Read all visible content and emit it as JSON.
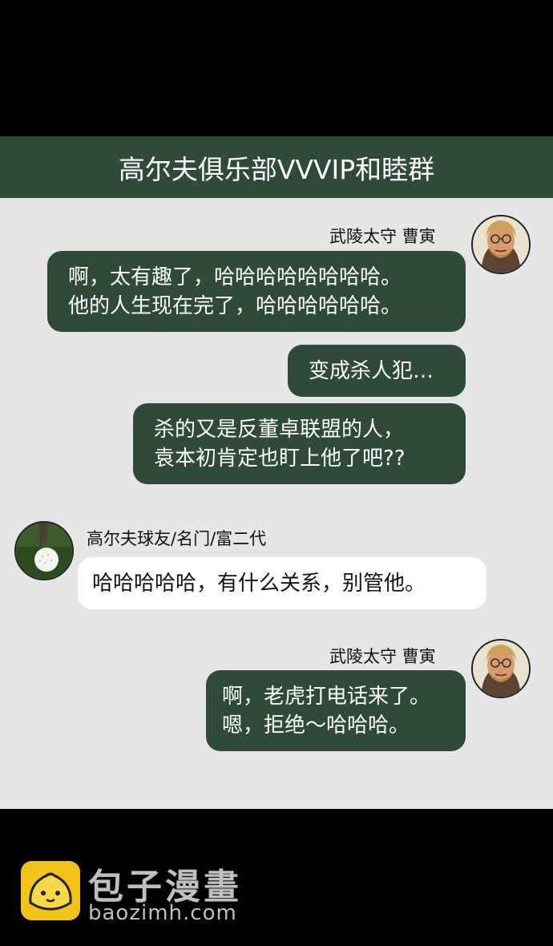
{
  "header": {
    "title": "高尔夫俱乐部VVVIP和睦群"
  },
  "messages": [
    {
      "sender": "武陵太守 曹寅",
      "bubbles": [
        {
          "lines": [
            "啊，太有趣了，哈哈哈哈哈哈哈哈。",
            "他的人生现在完了，哈哈哈哈哈哈。"
          ]
        },
        {
          "lines": [
            "变成杀人犯…"
          ]
        },
        {
          "lines": [
            "杀的又是反董卓联盟的人，",
            "袁本初肯定也盯上他了吧??"
          ]
        }
      ]
    },
    {
      "sender": "高尔夫球友/名门/富二代",
      "bubbles": [
        {
          "lines": [
            "哈哈哈哈哈，有什么关系，别管他。"
          ]
        }
      ]
    },
    {
      "sender": "武陵太守 曹寅",
      "bubbles": [
        {
          "lines": [
            "啊，老虎打电话来了。",
            "嗯，拒绝～哈哈哈。"
          ]
        }
      ]
    }
  ],
  "footer": {
    "brand": "包子漫畫",
    "url": "baozimh.com"
  },
  "colors": {
    "header_bg": "#2f4a38",
    "chat_bg": "#e6e6e6",
    "own_bubble": "#2f4a38",
    "other_bubble": "#ffffff",
    "logo_yellow": "#f2c318"
  },
  "icons": {
    "avatar_1": "bearded-man-glasses-avatar",
    "avatar_2": "golf-ball-avatar",
    "logo": "steamed-bun-logo-icon"
  }
}
